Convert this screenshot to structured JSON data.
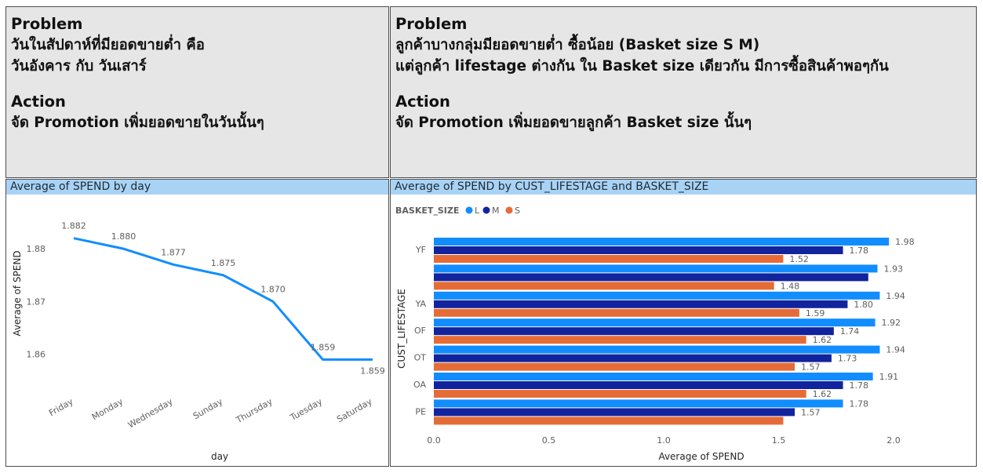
{
  "left_panel": {
    "problem_heading": "Problem",
    "problem_lines": [
      "วันในสัปดาห์ที่มียอดขายต่ำ คือ",
      "วันอังคาร กับ วันเสาร์"
    ],
    "action_heading": "Action",
    "action_lines": [
      "จัด Promotion เพิ่มยอดขายในวันนั้นๆ"
    ]
  },
  "right_panel": {
    "problem_heading": "Problem",
    "problem_lines": [
      "ลูกค้าบางกลุ่มมียอดขายต่ำ ซื้อน้อย (Basket size S M)",
      "แต่ลูกค้า lifestage ต่างกัน ใน Basket size เดียวกัน มีการซื้อสินค้าพอๆกัน"
    ],
    "action_heading": "Action",
    "action_lines": [
      "จัด Promotion เพิ่มยอดขายลูกค้า Basket size นั้นๆ"
    ]
  },
  "chart_data": [
    {
      "type": "line",
      "title": "Average of SPEND by day",
      "xlabel": "day",
      "ylabel": "Average of SPEND",
      "categories": [
        "Friday",
        "Monday",
        "Wednesday",
        "Sunday",
        "Thursday",
        "Tuesday",
        "Saturday"
      ],
      "values": [
        1.882,
        1.88,
        1.877,
        1.875,
        1.87,
        1.859,
        1.859
      ],
      "data_labels": [
        "1.882",
        "1.880",
        "1.877",
        "1.875",
        "1.870",
        "1.859",
        "1.859"
      ],
      "yticks": [
        "1.86",
        "1.87",
        "1.88"
      ],
      "ylim": [
        1.8552,
        1.8879
      ],
      "color": "#118dff",
      "grid": false
    },
    {
      "type": "bar",
      "orientation": "horizontal",
      "title": "Average of SPEND by CUST_LIFESTAGE and BASKET_SIZE",
      "xlabel": "Average of SPEND",
      "ylabel": "CUST_LIFESTAGE",
      "legend_title": "BASKET_SIZE",
      "legend_position": "top-left",
      "categories": [
        "YF",
        "",
        "YA",
        "OF",
        "OT",
        "OA",
        "PE"
      ],
      "xticks": [
        "0.0",
        "0.5",
        "1.0",
        "1.5",
        "2.0"
      ],
      "xlim": [
        0,
        2.0
      ],
      "series": [
        {
          "name": "L",
          "color": "#118dff",
          "values": [
            1.98,
            1.93,
            1.94,
            1.92,
            1.94,
            1.91,
            1.78
          ],
          "labels": [
            "1.98",
            "1.93",
            "1.94",
            "1.92",
            "1.94",
            "1.91",
            "1.78"
          ]
        },
        {
          "name": "M",
          "color": "#12239e",
          "values": [
            1.78,
            1.89,
            1.8,
            1.74,
            1.73,
            1.78,
            1.57
          ],
          "labels": [
            "1.78",
            "",
            "1.80",
            "1.74",
            "1.73",
            "1.78",
            "1.57"
          ]
        },
        {
          "name": "S",
          "color": "#e66c37",
          "values": [
            1.52,
            1.48,
            1.59,
            1.62,
            1.57,
            1.62,
            1.52
          ],
          "labels": [
            "1.52",
            "1.48",
            "1.59",
            "1.62",
            "1.57",
            "1.62",
            ""
          ]
        }
      ],
      "grid": false
    }
  ]
}
